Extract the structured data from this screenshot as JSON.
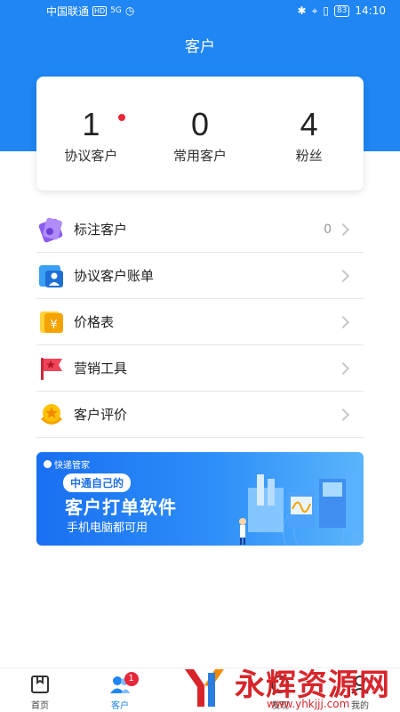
{
  "status_bar": {
    "carrier": "中国联通",
    "hd": "HD",
    "signal": "5G",
    "battery": "83",
    "time": "14:10"
  },
  "page_title": "客户",
  "stats": [
    {
      "value": "1",
      "label": "协议客户",
      "has_dot": true
    },
    {
      "value": "0",
      "label": "常用客户"
    },
    {
      "value": "4",
      "label": "粉丝"
    }
  ],
  "menu": [
    {
      "label": "标注客户",
      "count": "0",
      "icon": "tag-icon"
    },
    {
      "label": "协议客户账单",
      "icon": "bill-user-icon"
    },
    {
      "label": "价格表",
      "icon": "price-icon"
    },
    {
      "label": "营销工具",
      "icon": "marketing-flag-icon"
    },
    {
      "label": "客户评价",
      "icon": "rating-badge-icon"
    }
  ],
  "banner": {
    "brand": "快递管家",
    "tag": "中通自己的",
    "title": "客户打单软件",
    "subtitle": "手机电脑都可用"
  },
  "tabs": [
    {
      "label": "首页",
      "icon": "home-icon"
    },
    {
      "label": "客户",
      "icon": "customers-icon",
      "badge": "1",
      "active": true
    },
    {
      "label": "",
      "icon": "center-icon"
    },
    {
      "label": "发现",
      "icon": "discover-icon"
    },
    {
      "label": "我的",
      "icon": "profile-icon"
    }
  ],
  "watermark": {
    "text": "永辉资源网",
    "url": "www.yhkjjj.com"
  },
  "colors": {
    "primary": "#1f86f4",
    "badge": "#e8273a",
    "watermark": "#d7252b"
  }
}
